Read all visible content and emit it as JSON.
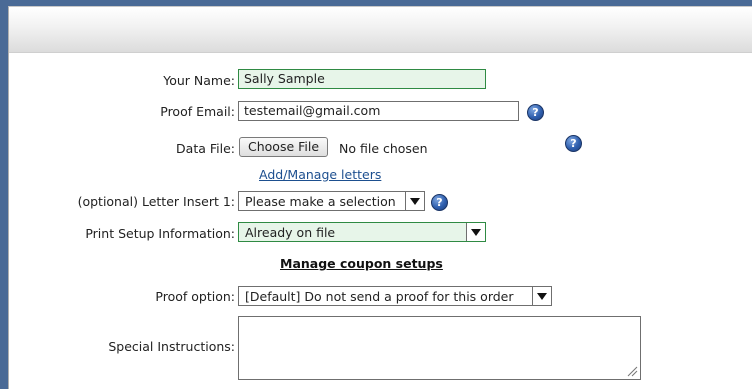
{
  "form": {
    "name": {
      "label": "Your Name:",
      "value": "Sally Sample"
    },
    "proof_email": {
      "label": "Proof Email:",
      "value": "testemail@gmail.com"
    },
    "data_file": {
      "label": "Data File:",
      "button": "Choose File",
      "status": "No file chosen"
    },
    "manage_letters_link": "Add/Manage letters",
    "letter_insert": {
      "label": "(optional) Letter Insert 1:",
      "selected": "Please make a selection"
    },
    "print_setup": {
      "label": "Print Setup Information:",
      "selected": "Already on file"
    },
    "manage_coupon_link": "Manage coupon setups",
    "proof_option": {
      "label": "Proof option:",
      "selected": "[Default] Do not send a proof for this order"
    },
    "special_instructions": {
      "label": "Special Instructions:",
      "value": ""
    }
  },
  "help_icon_glyph": "?",
  "colors": {
    "background": "#4a6a96",
    "help_icon": "#2f5fae",
    "highlight_field": "#e7f5e9",
    "highlight_border": "#2f8a43",
    "link": "#1d4f8f"
  }
}
